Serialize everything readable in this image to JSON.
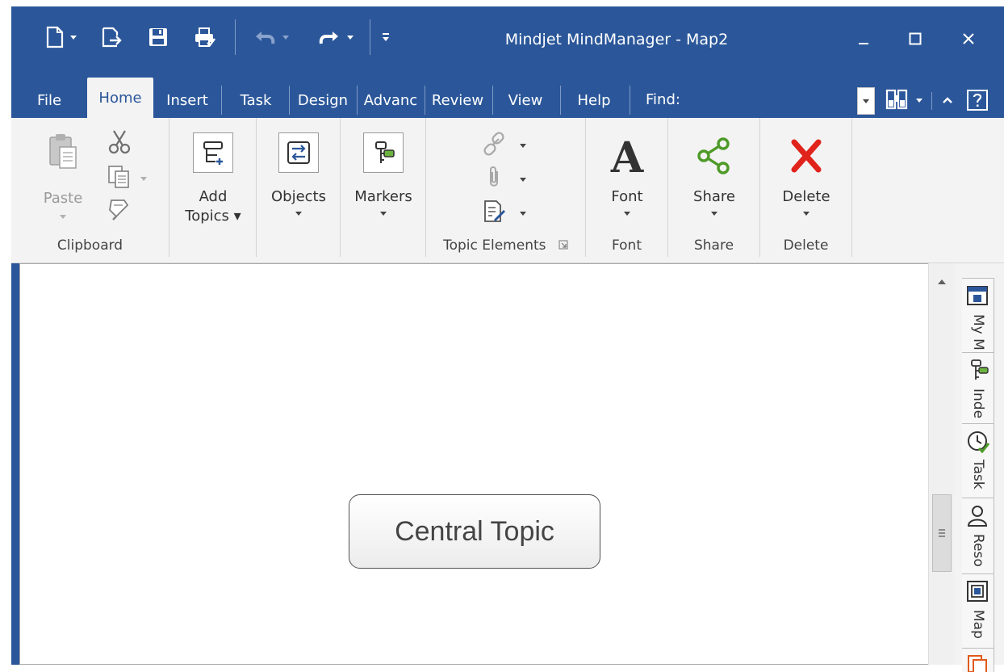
{
  "window": {
    "title": "Mindjet MindManager - Map2",
    "accent_color": "#2b579a",
    "quick_access": [
      {
        "name": "new-document-icon"
      },
      {
        "name": "open-file-icon"
      },
      {
        "name": "save-icon"
      },
      {
        "name": "print-icon"
      },
      {
        "name": "undo-icon"
      },
      {
        "name": "redo-icon"
      },
      {
        "name": "customize-toolbar-icon"
      }
    ],
    "controls": [
      "minimize-icon",
      "maximize-icon",
      "close-icon"
    ]
  },
  "tabs": {
    "items": [
      "File",
      "Home",
      "Insert",
      "Task",
      "Design",
      "Advanc",
      "Review",
      "View",
      "Help"
    ],
    "active": "Home",
    "find_label": "Find:"
  },
  "ribbon": {
    "clipboard": {
      "paste_label": "Paste",
      "group_label": "Clipboard"
    },
    "add_topics": {
      "line1": "Add",
      "line2": "Topics ▾"
    },
    "objects": {
      "label": "Objects"
    },
    "markers": {
      "label": "Markers"
    },
    "topic_elements": {
      "group_label": "Topic Elements"
    },
    "font": {
      "button_label": "Font",
      "group_label": "Font"
    },
    "share": {
      "button_label": "Share",
      "group_label": "Share"
    },
    "delete": {
      "button_label": "Delete",
      "group_label": "Delete"
    }
  },
  "canvas": {
    "central_topic": "Central Topic"
  },
  "side_pane": {
    "tabs": [
      {
        "label": "My M",
        "icon": "my-maps-icon"
      },
      {
        "label": "Inde",
        "icon": "index-icon"
      },
      {
        "label": "Task",
        "icon": "task-info-icon"
      },
      {
        "label": "Reso",
        "icon": "resources-icon"
      },
      {
        "label": "Map",
        "icon": "map-parts-icon"
      }
    ]
  }
}
